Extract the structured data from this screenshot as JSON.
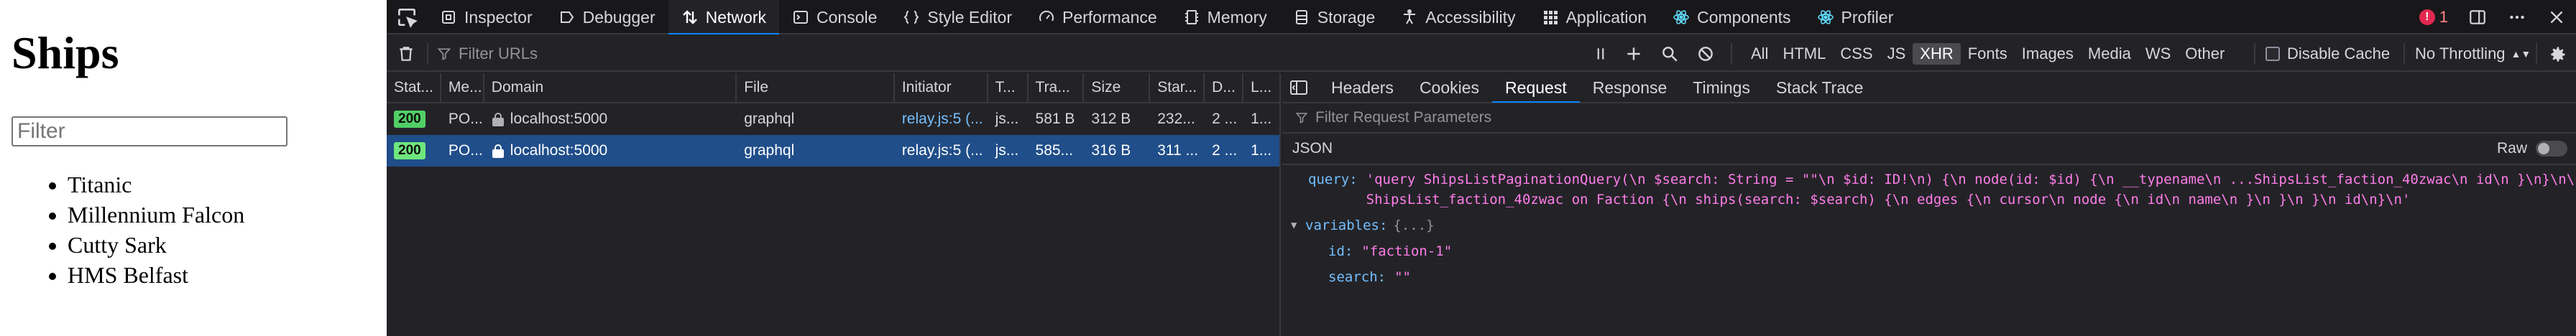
{
  "page": {
    "title": "Ships",
    "filter_placeholder": "Filter",
    "ships": [
      "Titanic",
      "Millennium Falcon",
      "Cutty Sark",
      "HMS Belfast"
    ]
  },
  "devtools": {
    "tools": [
      {
        "label": "Inspector",
        "icon": "inspector-icon"
      },
      {
        "label": "Debugger",
        "icon": "debugger-icon"
      },
      {
        "label": "Network",
        "icon": "network-icon",
        "selected": true
      },
      {
        "label": "Console",
        "icon": "console-icon"
      },
      {
        "label": "Style Editor",
        "icon": "style-editor-icon"
      },
      {
        "label": "Performance",
        "icon": "performance-icon"
      },
      {
        "label": "Memory",
        "icon": "memory-icon"
      },
      {
        "label": "Storage",
        "icon": "storage-icon"
      },
      {
        "label": "Accessibility",
        "icon": "accessibility-icon"
      },
      {
        "label": "Application",
        "icon": "application-icon"
      },
      {
        "label": "Components",
        "icon": "react-components-icon"
      },
      {
        "label": "Profiler",
        "icon": "react-profiler-icon"
      }
    ],
    "error_count": "1",
    "toolbar": {
      "filter_placeholder": "Filter URLs",
      "type_filters": [
        "All",
        "HTML",
        "CSS",
        "JS",
        "XHR",
        "Fonts",
        "Images",
        "Media",
        "WS",
        "Other"
      ],
      "active_type_filter": "XHR",
      "disable_cache": "Disable Cache",
      "throttling": "No Throttling"
    },
    "columns": [
      "Stat...",
      "Me...",
      "Domain",
      "File",
      "Initiator",
      "T...",
      "Tra...",
      "Size",
      "Star...",
      "D...",
      "L..."
    ],
    "requests": [
      {
        "status": "200",
        "method": "PO...",
        "domain": "localhost:5000",
        "file": "graphql",
        "initiator": "relay.js:5 (...",
        "type": "js...",
        "transferred": "581 B",
        "size": "312 B",
        "start": "232...",
        "duration": "2 ...",
        "latency": "1..."
      },
      {
        "status": "200",
        "method": "PO...",
        "domain": "localhost:5000",
        "file": "graphql",
        "initiator": "relay.js:5 (...",
        "type": "js...",
        "transferred": "585...",
        "size": "316 B",
        "start": "311 ...",
        "duration": "2 ...",
        "latency": "1..."
      }
    ],
    "detail_tabs": [
      "Headers",
      "Cookies",
      "Request",
      "Response",
      "Timings",
      "Stack Trace"
    ],
    "selected_detail_tab": "Request",
    "param_filter_placeholder": "Filter Request Parameters",
    "json_label": "JSON",
    "raw_label": "Raw",
    "request_body": {
      "query_key": "query:",
      "query_line1": "'query ShipsListPaginationQuery(\\n  $search: String = \"\"\\n  $id: ID!\\n) {\\n  node(id: $id) {\\n    __typename\\n    ...ShipsList_faction_40zwac\\n    id\\n  }\\n}\\n\\nfragment",
      "query_line2": "ShipsList_faction_40zwac on Faction {\\n  ships(search: $search) {\\n    edges {\\n      cursor\\n      node {\\n        id\\n        name\\n      }\\n    }\\n  }\\n  id\\n}\\n'",
      "variables_key": "variables:",
      "variables_summary": "{...}",
      "id_key": "id:",
      "id_value": "\"faction-1\"",
      "search_key": "search:",
      "search_value": "\"\""
    }
  },
  "colors": {
    "devtools_bg": "#232327",
    "tabbar_bg": "#18181a",
    "selected_row": "#204e8a",
    "status_ok": "#51cf66",
    "json_key": "#75bfff",
    "json_string": "#ff7de9"
  }
}
